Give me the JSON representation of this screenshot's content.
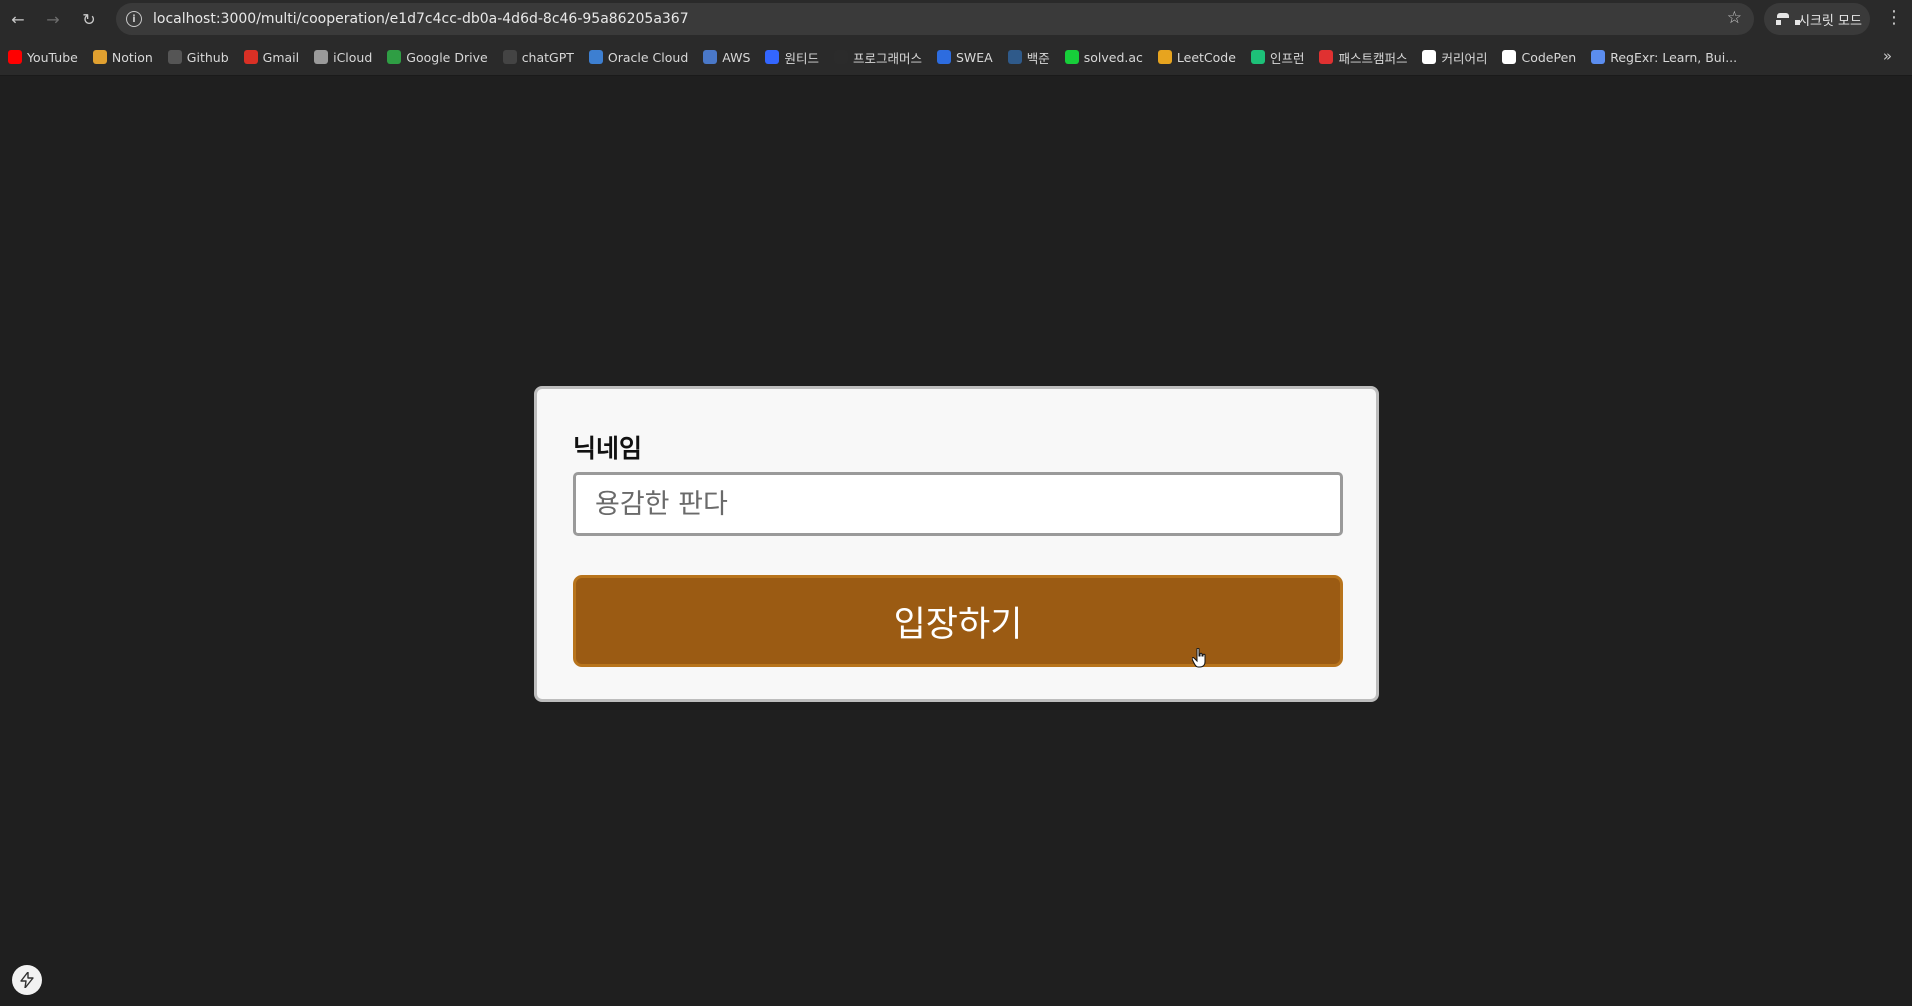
{
  "browser": {
    "url": "localhost:3000/multi/cooperation/e1d7c4cc-db0a-4d6d-8c46-95a86205a367",
    "incognito_label": "시크릿 모드",
    "bookmarks": [
      {
        "label": "YouTube",
        "icon": "youtube-icon",
        "color": "#ff0000"
      },
      {
        "label": "Notion",
        "icon": "notion-icon",
        "color": "#e0a030"
      },
      {
        "label": "Github",
        "icon": "github-icon",
        "color": "#555555"
      },
      {
        "label": "Gmail",
        "icon": "gmail-icon",
        "color": "#d93025"
      },
      {
        "label": "iCloud",
        "icon": "apple-icon",
        "color": "#9a9a9a"
      },
      {
        "label": "Google Drive",
        "icon": "google-drive-icon",
        "color": "#2f9e44"
      },
      {
        "label": "chatGPT",
        "icon": "chatgpt-icon",
        "color": "#444444"
      },
      {
        "label": "Oracle Cloud",
        "icon": "cloud-icon",
        "color": "#3d7fd1"
      },
      {
        "label": "AWS",
        "icon": "aws-icon",
        "color": "#4a78c8"
      },
      {
        "label": "원티드",
        "icon": "wanted-icon",
        "color": "#3366ff"
      },
      {
        "label": "프로그래머스",
        "icon": "programmers-icon",
        "color": "#2b2b2b"
      },
      {
        "label": "SWEA",
        "icon": "swea-icon",
        "color": "#2d6cdf"
      },
      {
        "label": "백준",
        "icon": "baekjoon-icon",
        "color": "#2f5a8a"
      },
      {
        "label": "solved.ac",
        "icon": "solved-ac-icon",
        "color": "#17ce3a"
      },
      {
        "label": "LeetCode",
        "icon": "leetcode-icon",
        "color": "#e7a41f"
      },
      {
        "label": "인프런",
        "icon": "inflearn-icon",
        "color": "#1dc078"
      },
      {
        "label": "패스트캠퍼스",
        "icon": "fastcampus-icon",
        "color": "#e03131"
      },
      {
        "label": "커리어리",
        "icon": "careerly-icon",
        "color": "#ffffff"
      },
      {
        "label": "CodePen",
        "icon": "codepen-icon",
        "color": "#ffffff"
      },
      {
        "label": "RegExr: Learn, Bui...",
        "icon": "regexr-icon",
        "color": "#5b8def"
      }
    ]
  },
  "form": {
    "nickname_label": "닉네임",
    "nickname_placeholder": "용감한 판다",
    "nickname_value": "",
    "enter_button_label": "입장하기"
  },
  "colors": {
    "page_background": "#1f1f1f",
    "button": "#9b5b13"
  }
}
